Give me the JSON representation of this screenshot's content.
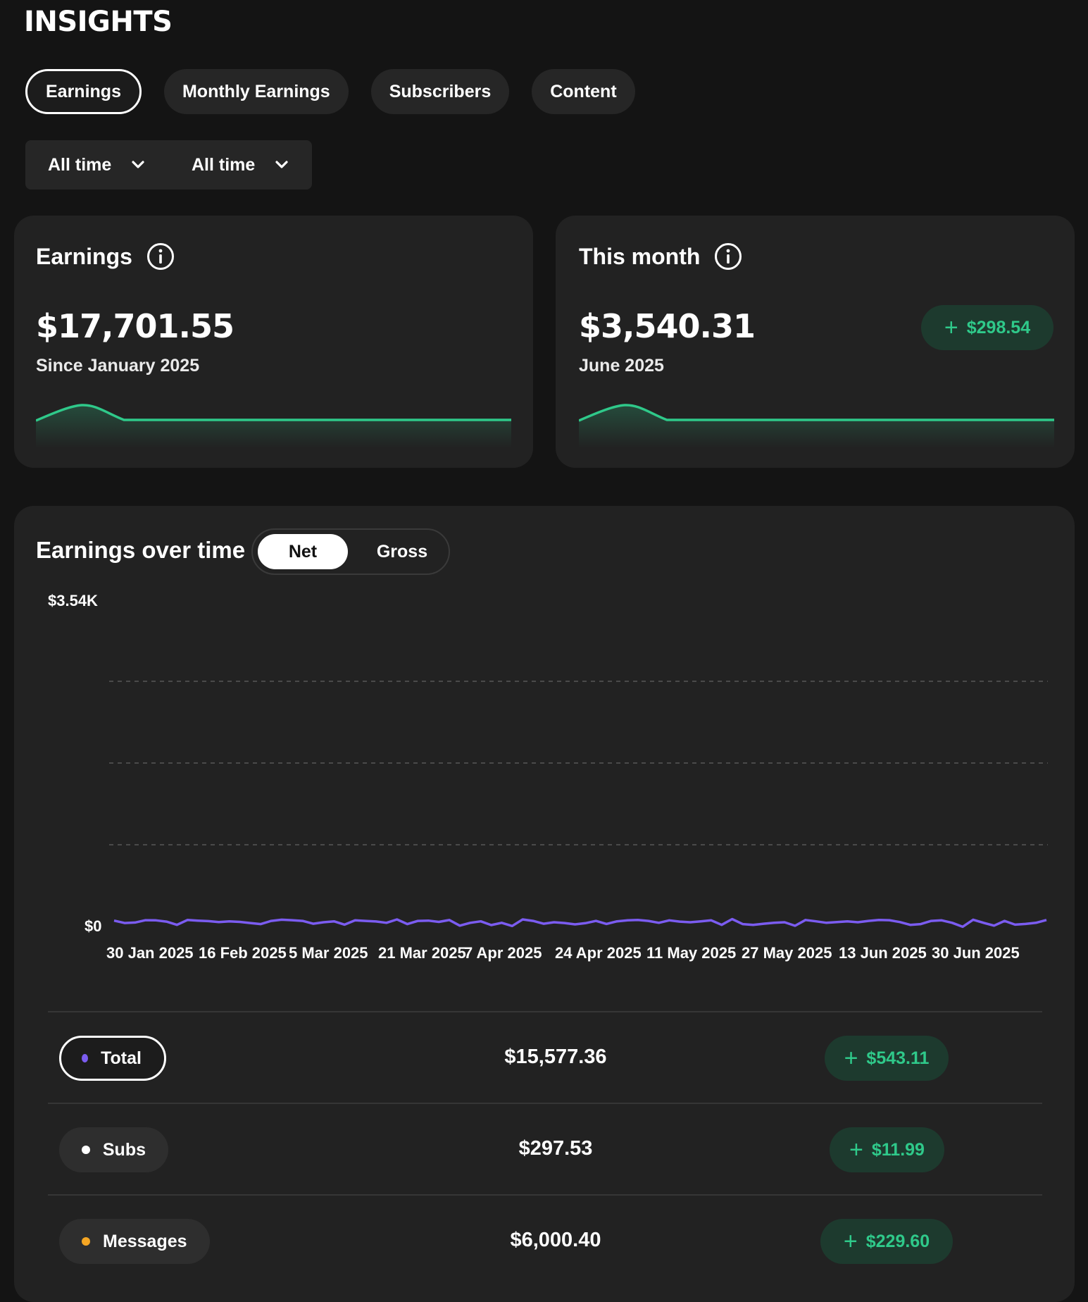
{
  "header": {
    "title": "INSIGHTS"
  },
  "tabs": [
    {
      "label": "Earnings",
      "active": true
    },
    {
      "label": "Monthly Earnings",
      "active": false
    },
    {
      "label": "Subscribers",
      "active": false
    },
    {
      "label": "Content",
      "active": false
    }
  ],
  "filters": [
    {
      "label": "All time",
      "icon": "chevron-down-icon"
    },
    {
      "label": "All time",
      "icon": "chevron-down-icon"
    }
  ],
  "earnings_card": {
    "title": "Earnings",
    "icon": "info-icon",
    "value": "$17,701.55",
    "subtitle": "Since January 2025",
    "spark_color": "#2fc98a"
  },
  "month_card": {
    "title": "This month",
    "icon": "info-icon",
    "value": "$3,540.31",
    "subtitle": "June 2025",
    "delta": "$298.54",
    "spark_color": "#2fc98a"
  },
  "chart_card": {
    "title": "Earnings over time",
    "toggle": [
      {
        "label": "Net",
        "active": true
      },
      {
        "label": "Gross",
        "active": false
      }
    ]
  },
  "chart_data": {
    "type": "line",
    "ylim": [
      0,
      3540
    ],
    "y_tick_labels": [
      "$3.54K",
      "$0"
    ],
    "x_tick_labels": [
      "30 Jan 2025",
      "16 Feb 2025",
      "5 Mar 2025",
      "21 Mar 2025",
      "7 Apr 2025",
      "24 Apr 2025",
      "11 May 2025",
      "27 May 2025",
      "13 Jun 2025",
      "30 Jun 2025"
    ],
    "grid": "horizontal dashed",
    "series": [
      {
        "color": "#7b5cf0",
        "values": [
          115,
          90,
          95,
          120,
          118,
          105,
          70,
          122,
          115,
          110,
          100,
          108,
          102,
          90,
          78,
          112,
          125,
          120,
          112,
          82,
          98,
          108,
          72,
          118,
          112,
          106,
          92,
          128,
          78,
          112,
          115,
          102,
          122,
          62,
          92,
          108,
          68,
          92,
          58,
          128,
          112,
          82,
          98,
          90,
          75,
          88,
          112,
          80,
          108,
          118,
          122,
          112,
          92,
          118,
          105,
          98,
          108,
          118,
          70,
          132,
          78,
          70,
          82,
          92,
          98,
          60,
          122,
          108,
          92,
          100,
          108,
          98,
          112,
          122,
          120,
          100,
          70,
          78,
          112,
          118,
          92,
          50,
          125,
          92,
          62,
          112,
          72,
          80,
          92,
          122
        ]
      }
    ]
  },
  "breakdown": [
    {
      "label": "Total",
      "value": "$15,577.36",
      "delta": "$543.11",
      "dot_color": "#7b5cf0",
      "active": true
    },
    {
      "label": "Subs",
      "value": "$297.53",
      "delta": "$11.99",
      "dot_color": "#ffffff",
      "active": false
    },
    {
      "label": "Messages",
      "value": "$6,000.40",
      "delta": "$229.60",
      "dot_color": "#f5a623",
      "active": false
    }
  ],
  "colors": {
    "background": "#141414",
    "card": "#222222",
    "accent_green": "#2fc98a",
    "delta_bg": "#1d3a2e",
    "line": "#7b5cf0"
  }
}
